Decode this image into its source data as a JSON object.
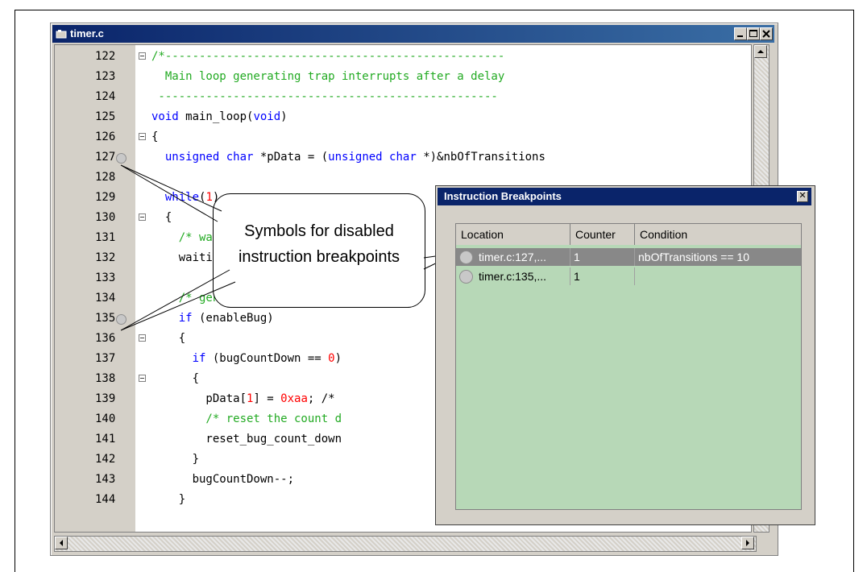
{
  "editor": {
    "title": "timer.c",
    "lines": [
      {
        "num": "122",
        "code": "/*--------------------------------------------------"
      },
      {
        "num": "123",
        "code": "  Main loop generating trap interrupts after a delay"
      },
      {
        "num": "124",
        "code": " --------------------------------------------------"
      },
      {
        "num": "125",
        "code": "void main_loop(void)"
      },
      {
        "num": "126",
        "code": "{"
      },
      {
        "num": "127",
        "code": "  unsigned char *pData = (unsigned char *)&nbOfTransitions"
      },
      {
        "num": "128",
        "code": ""
      },
      {
        "num": "129",
        "code": "  while(1)"
      },
      {
        "num": "130",
        "code": "  {"
      },
      {
        "num": "131",
        "code": "    /* wait for the switch to change */"
      },
      {
        "num": "132",
        "code": "    waiting_loop(state[currentState])"
      },
      {
        "num": "133",
        "code": ""
      },
      {
        "num": "134",
        "code": "    /* generate a bug */"
      },
      {
        "num": "135",
        "code": "    if (enableBug)"
      },
      {
        "num": "136",
        "code": "    {"
      },
      {
        "num": "137",
        "code": "      if (bugCountDown == 0)"
      },
      {
        "num": "138",
        "code": "      {"
      },
      {
        "num": "139",
        "code": "        pData[1] = 0xaa; /*"
      },
      {
        "num": "140",
        "code": "        /* reset the count d"
      },
      {
        "num": "141",
        "code": "        reset_bug_count_down"
      },
      {
        "num": "142",
        "code": "      }"
      },
      {
        "num": "143",
        "code": "      bugCountDown--;"
      },
      {
        "num": "144",
        "code": "    }"
      }
    ]
  },
  "callout": {
    "line1": "Symbols for disabled",
    "line2": "instruction breakpoints"
  },
  "breakpoints": {
    "title": "Instruction Breakpoints",
    "columns": [
      "Location",
      "Counter",
      "Condition"
    ],
    "rows": [
      {
        "location": "timer.c:127,...",
        "counter": "1",
        "condition": "nbOfTransitions == 10"
      },
      {
        "location": "timer.c:135,...",
        "counter": "1",
        "condition": ""
      }
    ]
  }
}
